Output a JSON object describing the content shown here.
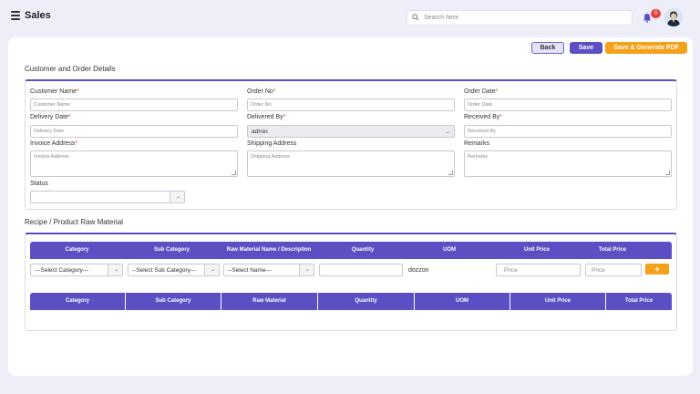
{
  "header": {
    "title": "Sales",
    "search_placeholder": "Search here",
    "notification_count": "0"
  },
  "toolbar": {
    "back_label": "Back",
    "save_label": "Save",
    "save_pdf_label": "Save & Generate PDF"
  },
  "customer_section": {
    "title": "Customer and Order Details",
    "customer_name": {
      "label": "Customer Name",
      "placeholder": "Customer Name"
    },
    "order_no": {
      "label": "Order No",
      "placeholder": "Order No"
    },
    "order_date": {
      "label": "Order Date",
      "placeholder": "Order Date"
    },
    "delivery_date": {
      "label": "Delivery Date",
      "placeholder": "Delivery Date"
    },
    "delivered_by": {
      "label": "Delivered By",
      "value": "admin"
    },
    "received_by": {
      "label": "Received By",
      "placeholder": "Received By"
    },
    "invoice_address": {
      "label": "Invoice Address",
      "placeholder": "Invoice Address"
    },
    "shipping_address": {
      "label": "Shipping Address",
      "placeholder": "Shipping Address"
    },
    "remarks": {
      "label": "Remarks",
      "placeholder": "Remarks"
    },
    "status": {
      "label": "Status",
      "value": ""
    }
  },
  "recipe_section": {
    "title": "Recipe / Product Raw Material",
    "entry_headers": [
      "Category",
      "Sub Category",
      "Raw Material Name / Description",
      "Quantity",
      "UOM",
      "Unit Price",
      "Total Price"
    ],
    "category_select": "---Select Category---",
    "subcategory_select": "--Select Sub Category---",
    "name_select": "--Select Name---",
    "quantity_value": "",
    "uom_value": "dozzon",
    "unit_price_placeholder": "Price",
    "total_price_placeholder": "Price",
    "add_label": "+",
    "table_headers": [
      "Category",
      "Sub Category",
      "Raw Material",
      "Quantity",
      "UOM",
      "Unit Price",
      "Total Price"
    ]
  },
  "colors": {
    "accent": "#5c4fc4",
    "orange": "#f5a11c",
    "badge": "#e8413c"
  }
}
